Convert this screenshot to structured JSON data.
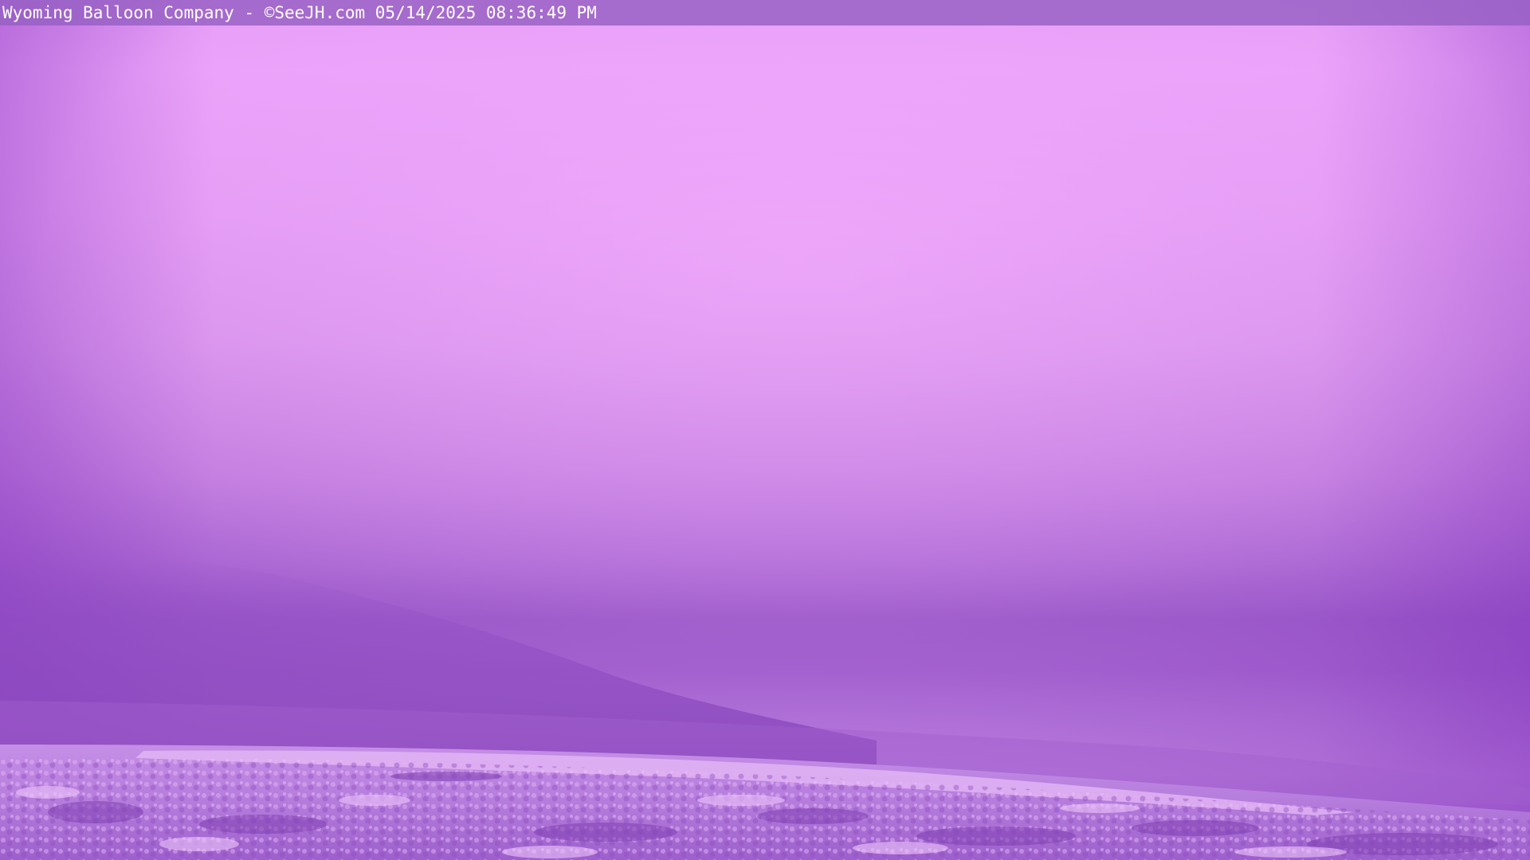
{
  "overlay": {
    "caption": "Wyoming Balloon Company - ©SeeJH.com 05/14/2025 08:36:49 PM"
  },
  "scene": {
    "description_tag": "webcam-view",
    "colors": {
      "sky_light": "#eba2fa",
      "sky_mid": "#d893ec",
      "haze_dark": "#9e5ccb",
      "ridge": "#8a48bd",
      "field_light": "#d9a3ef",
      "field_dark": "#8e4cbd",
      "overlay_bar": "#965fc3"
    }
  }
}
